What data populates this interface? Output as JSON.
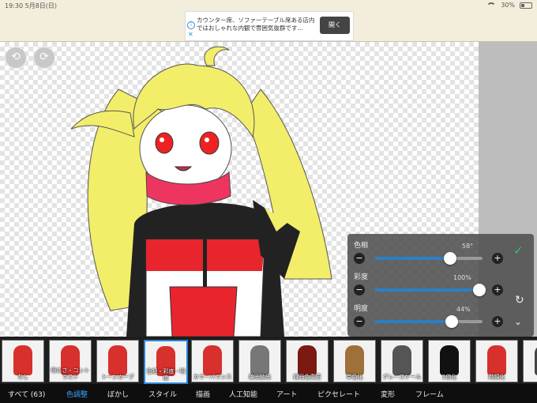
{
  "statusbar": {
    "time": "19:30",
    "date": "5月8日(日)",
    "battery": "30%"
  },
  "ad": {
    "text": "カウンター席、ソファーテーブル席ある店内ではおしゃれな内観で雰囲気抜群です…",
    "button": "開く"
  },
  "adjust": {
    "hue": {
      "label": "色相",
      "value": "58°",
      "level": 0.7
    },
    "saturation": {
      "label": "彩度",
      "value": "100%",
      "level": 0.97
    },
    "brightness": {
      "label": "明度",
      "value": "44%",
      "level": 0.71
    }
  },
  "filters": [
    {
      "label": "なし",
      "color": "#d8302c"
    },
    {
      "label": "明るさ・コントラスト",
      "color": "#d8302c"
    },
    {
      "label": "トーンカーブ",
      "color": "#d8302c"
    },
    {
      "label": "色相・彩度・明度",
      "color": "#d8302c"
    },
    {
      "label": "カラーバランス",
      "color": "#d8302c"
    },
    {
      "label": "線画抽出",
      "color": "#777777"
    },
    {
      "label": "線画色変更",
      "color": "#7a1a12"
    },
    {
      "label": "単色化",
      "color": "#a0703a"
    },
    {
      "label": "グレースケール",
      "color": "#555555"
    },
    {
      "label": "2値化",
      "color": "#111111"
    },
    {
      "label": "階調化",
      "color": "#d8302c"
    },
    {
      "label": "グ",
      "color": "#444444"
    }
  ],
  "categories": [
    "すべて (63)",
    "色調整",
    "ぼかし",
    "スタイル",
    "描画",
    "人工知能",
    "アート",
    "ピクセレート",
    "変形",
    "フレーム"
  ],
  "active_category": "色調整",
  "colors": {
    "accent": "#2a86d6",
    "confirm": "#31c96a"
  }
}
